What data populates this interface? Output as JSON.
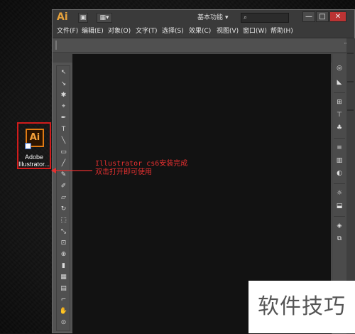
{
  "desktop": {
    "shortcut": {
      "icon_text": "Ai",
      "label_line1": "Adobe",
      "label_line2": "Illustrator..."
    }
  },
  "window": {
    "logo": "Ai",
    "workspace": "基本功能",
    "menu": [
      "文件(F)",
      "编辑(E)",
      "对象(O)",
      "文字(T)",
      "选择(S)",
      "效果(C)",
      "视图(V)",
      "窗口(W)",
      "帮助(H)"
    ],
    "window_controls": {
      "minimize": "—",
      "maximize": "□",
      "close": "✕"
    },
    "tools": [
      "↖",
      "↘",
      "✱",
      "⌖",
      "✒",
      "T",
      "╲",
      "▭",
      "╱",
      "✎",
      "✐",
      "▱",
      "↻",
      "⬚",
      "⤡",
      "⊡",
      "⊕",
      "▮",
      "▦",
      "▤",
      "⌐",
      "✋",
      "⊙"
    ],
    "panel_icons": [
      "◎",
      "◣",
      "⊞",
      "⊤",
      "♣",
      "≡",
      "▥",
      "◐",
      "☼",
      "⬓",
      "◈",
      "⧉"
    ]
  },
  "annotation": {
    "line1": "Illustrator cs6安装完成",
    "line2": "双击打开即可使用"
  },
  "watermark": "软件技巧"
}
